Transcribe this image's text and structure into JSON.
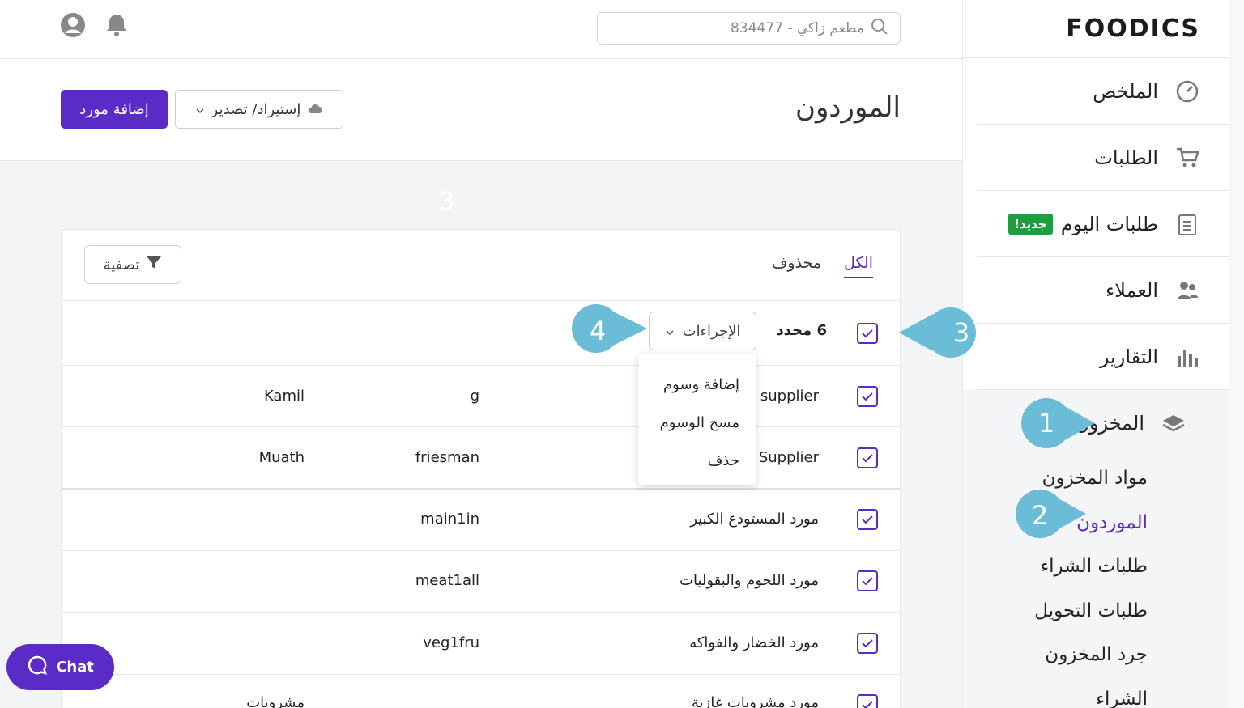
{
  "app": {
    "logo": "FOODICS"
  },
  "search": {
    "placeholder": "مطعم زاكي - 834477"
  },
  "sidebar": {
    "items": [
      {
        "label": "الملخص"
      },
      {
        "label": "الطلبات"
      },
      {
        "label": "طلبات اليوم",
        "badge": "جديد!"
      },
      {
        "label": "العملاء"
      },
      {
        "label": "التقارير"
      }
    ],
    "inventory": {
      "label": "المخزون",
      "sub": [
        "مواد المخزون",
        "الموردون",
        "طلبات الشراء",
        "طلبات التحويل",
        "جرد المخزون",
        "الشراء"
      ]
    }
  },
  "header": {
    "title": "الموردون",
    "add_button": "إضافة مورد",
    "import_button": "إستيراد/ تصدير"
  },
  "tabs": {
    "all": "الكل",
    "deleted": "محذوف"
  },
  "filter_button": "تصفية",
  "selection": {
    "count": "6 محدد",
    "actions": "الإجراءات"
  },
  "dropdown": [
    "إضافة وسوم",
    "مسح الوسوم",
    "حذف"
  ],
  "rows": [
    {
      "name": "s supplier",
      "ref": "g",
      "col3": "Kamil"
    },
    {
      "name": "Supplier",
      "ref": "friesman",
      "col3": "Muath"
    },
    {
      "name": "مورد المستودع الكبير",
      "ref": "main1in",
      "col3": ""
    },
    {
      "name": "مورد اللحوم والبقوليات",
      "ref": "meat1all",
      "col3": ""
    },
    {
      "name": "مورد الخضار والفواكه",
      "ref": "veg1fru",
      "col3": ""
    },
    {
      "name": "مورد مشروبات غازية",
      "ref": "",
      "col3": "مشروبات"
    }
  ],
  "callouts": {
    "c1": "1",
    "c2": "2",
    "c3": "3",
    "c4": "4",
    "faded": "3"
  },
  "chat": {
    "label": "Chat"
  },
  "colors": {
    "accent": "#5b2bc7",
    "callout": "#6bbcd6",
    "badge": "#1f9d3f"
  }
}
